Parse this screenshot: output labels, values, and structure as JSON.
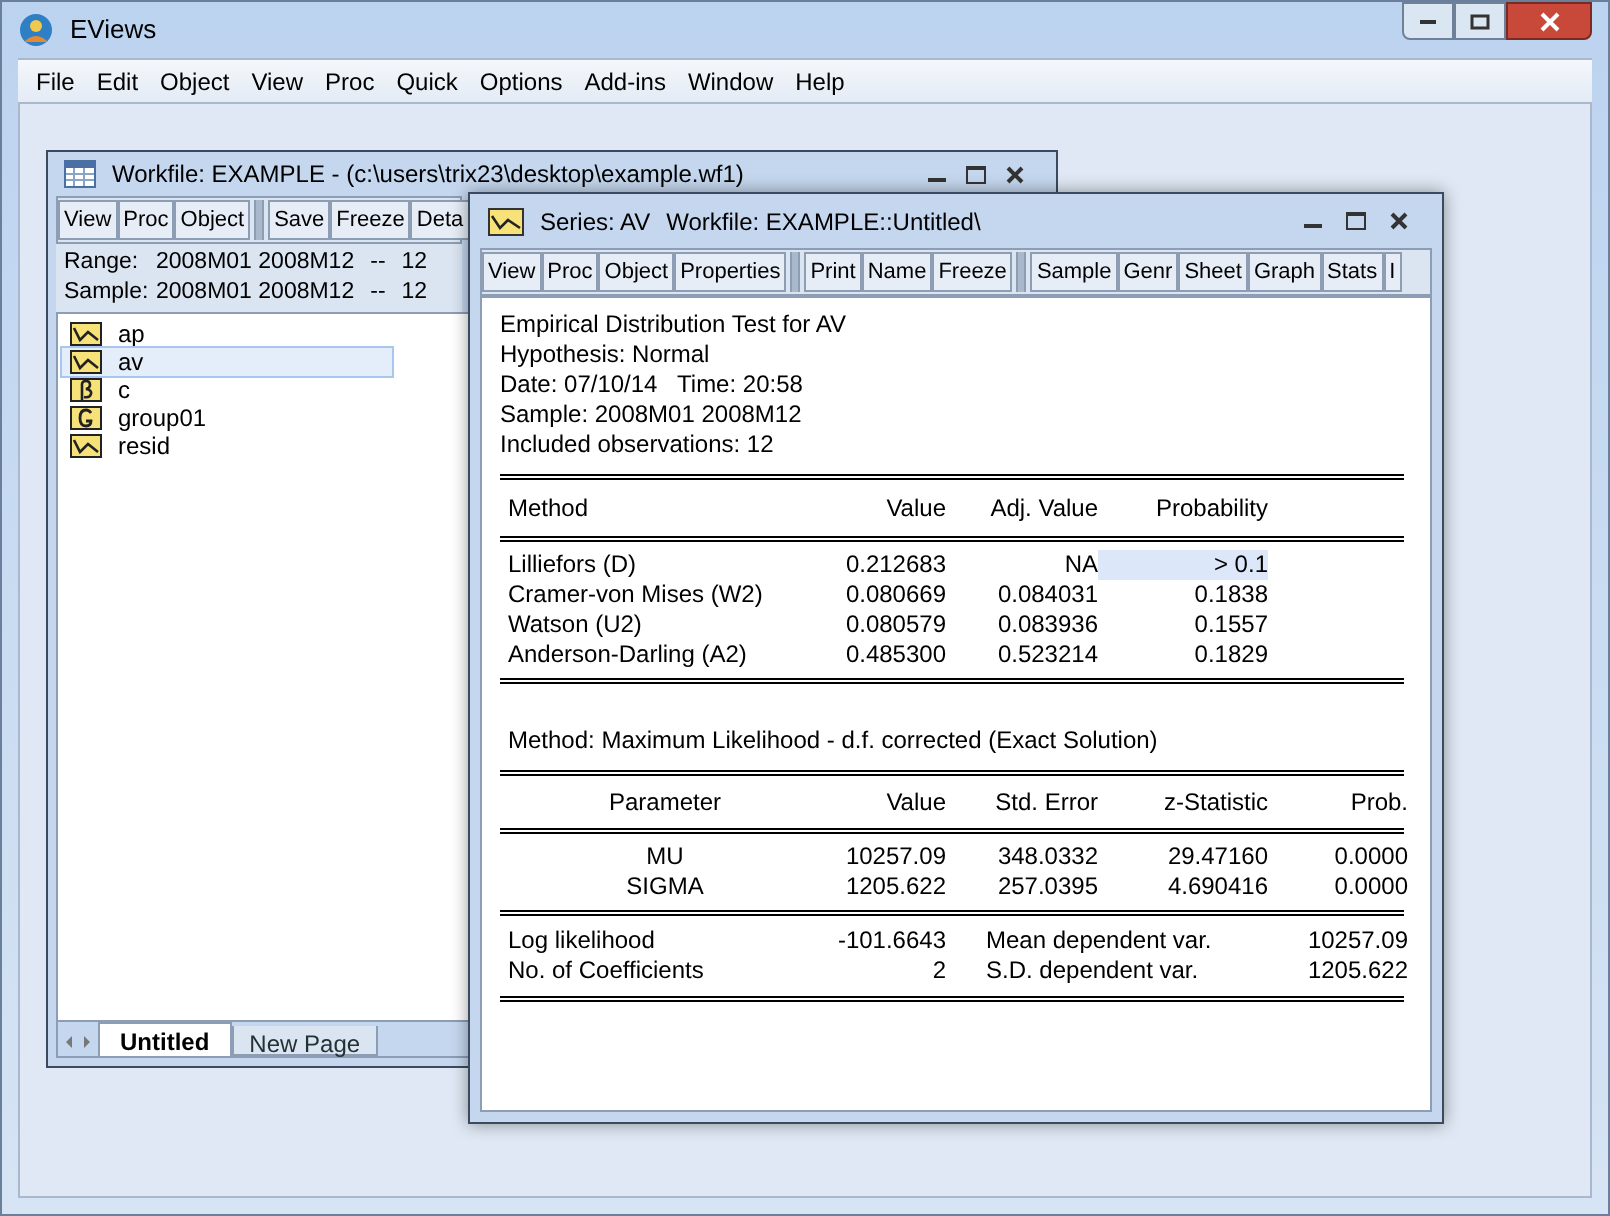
{
  "app": {
    "title": "EViews",
    "menu": [
      "File",
      "Edit",
      "Object",
      "View",
      "Proc",
      "Quick",
      "Options",
      "Add-ins",
      "Window",
      "Help"
    ]
  },
  "workfile": {
    "title": "Workfile: EXAMPLE - (c:\\users\\trix23\\desktop\\example.wf1)",
    "toolbar": [
      [
        "View",
        "Proc",
        "Object"
      ],
      [
        "Save",
        "Freeze",
        "Deta"
      ]
    ],
    "info": [
      {
        "label": "Range:",
        "value": "2008M01 2008M12",
        "sep": "--",
        "count": "12"
      },
      {
        "label": "Sample:",
        "value": "2008M01 2008M12",
        "sep": "--",
        "count": "12"
      }
    ],
    "objects": [
      {
        "name": "ap",
        "kind": "series",
        "selected": false
      },
      {
        "name": "av",
        "kind": "series",
        "selected": true
      },
      {
        "name": "c",
        "kind": "coef",
        "selected": false
      },
      {
        "name": "group01",
        "kind": "group",
        "selected": false
      },
      {
        "name": "resid",
        "kind": "series",
        "selected": false
      }
    ],
    "page_tabs": [
      {
        "label": "Untitled",
        "selected": true
      },
      {
        "label": "New Page",
        "selected": false
      }
    ]
  },
  "series": {
    "title": "Series: AV",
    "workfile": "Workfile: EXAMPLE::Untitled\\",
    "toolbar": [
      [
        "View",
        "Proc",
        "Object",
        "Properties"
      ],
      [
        "Print",
        "Name",
        "Freeze"
      ],
      [
        "Sample",
        "Genr",
        "Sheet",
        "Graph",
        "Stats",
        "I"
      ]
    ],
    "header_lines": [
      "Empirical Distribution Test for AV",
      "Hypothesis: Normal",
      "Date: 07/10/14   Time: 20:58",
      "Sample: 2008M01 2008M12",
      "Included observations: 12"
    ],
    "test_table": {
      "columns": [
        "Method",
        "Value",
        "Adj. Value",
        "Probability"
      ],
      "rows": [
        {
          "cells": [
            "Lilliefors (D)",
            "0.212683",
            "NA",
            "> 0.1"
          ],
          "probability_selected": true
        },
        {
          "cells": [
            "Cramer-von Mises (W2)",
            "0.080669",
            "0.084031",
            "0.1838"
          ],
          "probability_selected": false
        },
        {
          "cells": [
            "Watson (U2)",
            "0.080579",
            "0.083936",
            "0.1557"
          ],
          "probability_selected": false
        },
        {
          "cells": [
            "Anderson-Darling (A2)",
            "0.485300",
            "0.523214",
            "0.1829"
          ],
          "probability_selected": false
        }
      ]
    },
    "method_line": "Method: Maximum Likelihood - d.f. corrected (Exact Solution)",
    "param_table": {
      "columns": [
        "Parameter",
        "Value",
        "Std. Error",
        "z-Statistic",
        "Prob."
      ],
      "rows": [
        [
          "MU",
          "10257.09",
          "348.0332",
          "29.47160",
          "0.0000"
        ],
        [
          "SIGMA",
          "1205.622",
          "257.0395",
          "4.690416",
          "0.0000"
        ]
      ]
    },
    "stats": [
      [
        "Log likelihood",
        "-101.6643",
        "Mean dependent var.",
        "10257.09"
      ],
      [
        "No. of Coefficients",
        "2",
        "S.D. dependent var.",
        "1205.622"
      ]
    ]
  }
}
